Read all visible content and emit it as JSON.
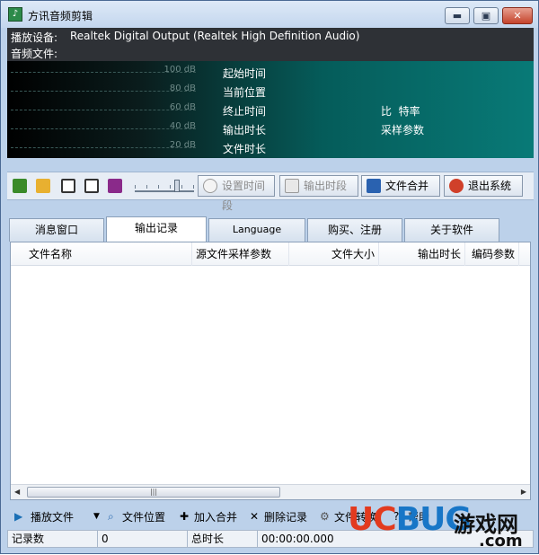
{
  "window": {
    "title": "方讯音频剪辑",
    "app_icon_glyph": "♪",
    "controls": {
      "minimize": "▬",
      "maximize": "▣",
      "close": "✕"
    }
  },
  "device": {
    "playback_label": "播放设备:",
    "playback_value": "Realtek Digital Output (Realtek High Definition Audio)",
    "file_label": "音频文件:"
  },
  "display": {
    "db_levels": [
      "100 dB",
      "80 dB",
      "60 dB",
      "40 dB",
      "20 dB"
    ],
    "labels": {
      "start_time": "起始时间",
      "current_pos": "当前位置",
      "end_time": "终止时间",
      "output_len": "输出时长",
      "file_len": "文件时长",
      "bitrate": "比  特率",
      "sample_params": "采样参数"
    }
  },
  "toolbar": {
    "icons": [
      "chip-icon",
      "folder-open-icon",
      "play-box-icon",
      "stop-box-icon",
      "book-icon"
    ],
    "set_segment": "设置时间段",
    "output_segment": "输出时段",
    "merge_files": "文件合并",
    "exit_system": "退出系统"
  },
  "tabs": [
    {
      "label": "消息窗口",
      "active": false
    },
    {
      "label": "输出记录",
      "active": true
    },
    {
      "label": "Language",
      "active": false
    },
    {
      "label": "购买、注册",
      "active": false
    },
    {
      "label": "关于软件",
      "active": false
    }
  ],
  "table": {
    "columns": [
      "文件名称",
      "源文件采样参数",
      "文件大小",
      "输出时长",
      "编码参数"
    ],
    "rows": [],
    "scroll_thumb_glyph": "|||"
  },
  "actions": {
    "play_file": "播放文件",
    "file_location": "文件位置",
    "add_merge": "加入合并",
    "delete_record": "删除记录",
    "file_conv": "文件转换",
    "help": "帮助"
  },
  "status": {
    "record_count_label": "记录数",
    "record_count_value": "0",
    "total_duration_label": "总时长",
    "total_duration_value": "00:00:00.000"
  },
  "watermark": {
    "brand_uc": "UC",
    "brand_bug": "BUG",
    "brand_cn": "游戏网",
    "brand_domain": ".com"
  },
  "colors": {
    "accent_teal": "#087a77",
    "title_bg": "#c3d6ee",
    "dark_panel": "#2e3136"
  }
}
